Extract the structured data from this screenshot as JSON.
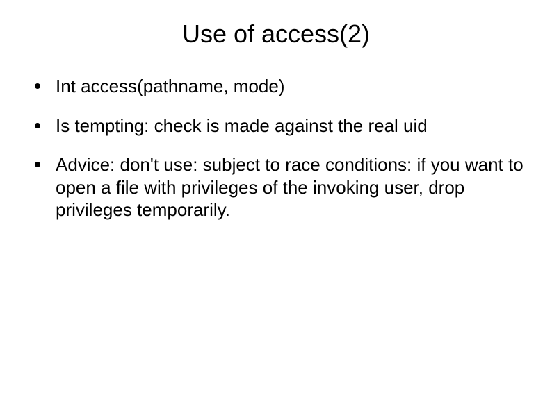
{
  "slide": {
    "title": "Use of access(2)",
    "bullets": [
      {
        "text": "Int access(pathname, mode)"
      },
      {
        "text": "Is tempting: check is made against the real uid"
      },
      {
        "text": "Advice: don't use: subject to race conditions: if you want to open a file with privileges of the invoking user, drop privileges temporarily."
      }
    ]
  }
}
